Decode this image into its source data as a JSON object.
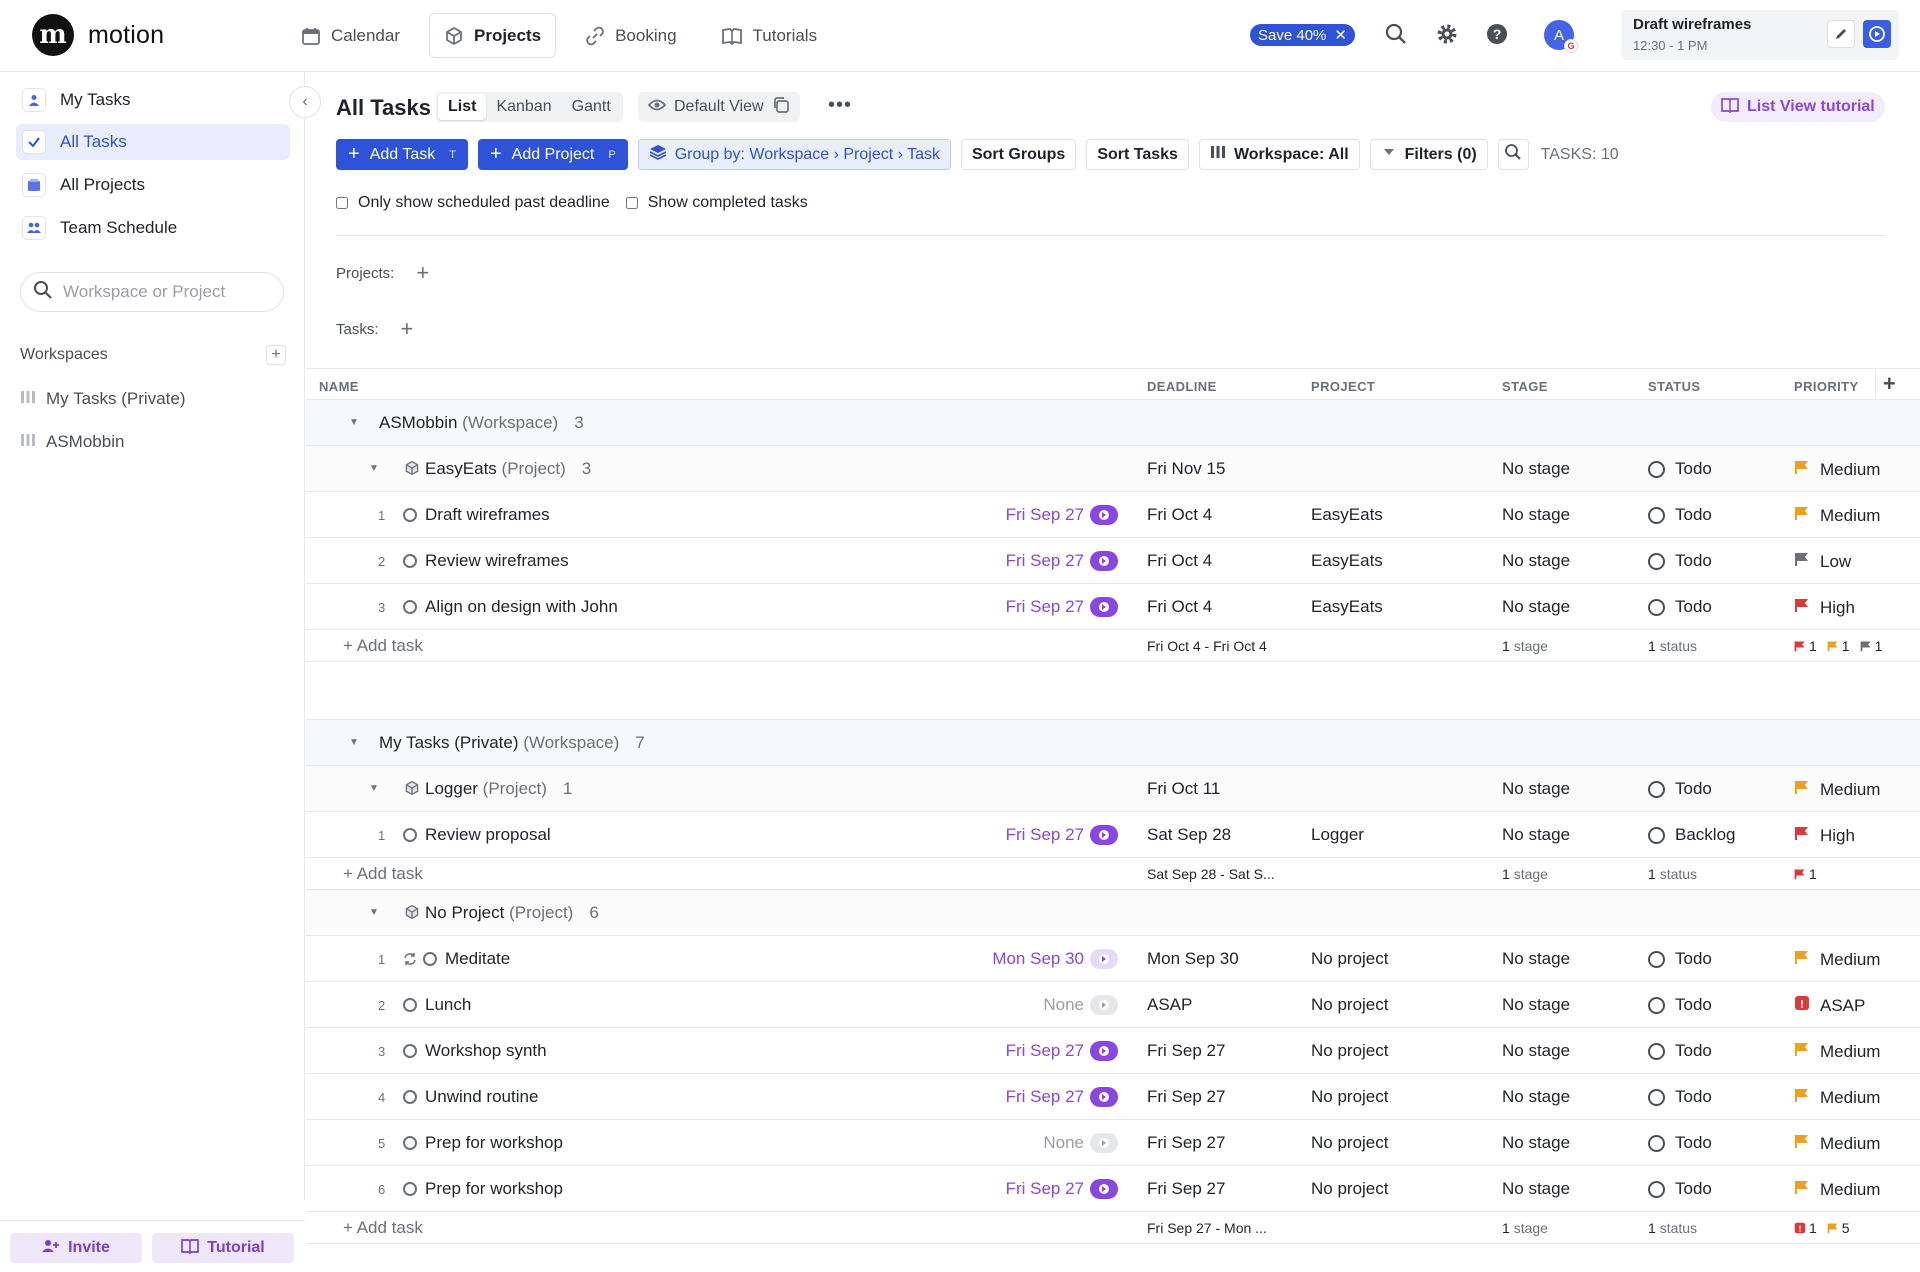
{
  "app": {
    "name": "motion"
  },
  "nav": {
    "calendar": "Calendar",
    "projects": "Projects",
    "booking": "Booking",
    "tutorials": "Tutorials"
  },
  "promo": {
    "label": "Save 40%"
  },
  "user": {
    "initial": "A"
  },
  "current_task": {
    "title": "Draft wireframes",
    "time": "12:30 - 1 PM"
  },
  "sidebar": {
    "items": [
      {
        "label": "My Tasks"
      },
      {
        "label": "All Tasks"
      },
      {
        "label": "All Projects"
      },
      {
        "label": "Team Schedule"
      }
    ],
    "search_placeholder": "Workspace or Project",
    "workspaces_heading": "Workspaces",
    "workspaces": [
      {
        "label": "My Tasks (Private)"
      },
      {
        "label": "ASMobbin"
      }
    ],
    "invite": "Invite",
    "tutorial": "Tutorial"
  },
  "page": {
    "title": "All Tasks",
    "view_tabs": [
      "List",
      "Kanban",
      "Gantt"
    ],
    "default_view": "Default View",
    "tutorial_link": "List View tutorial",
    "toolbar": {
      "add_task": "Add Task",
      "add_task_key": "T",
      "add_project": "Add Project",
      "add_project_key": "P",
      "group_by": "Group by: Workspace › Project › Task",
      "sort_groups": "Sort Groups",
      "sort_tasks": "Sort Tasks",
      "workspace": "Workspace: All",
      "filters": "Filters (0)",
      "task_count": "TASKS: 10"
    },
    "checks": {
      "past_deadline": "Only show scheduled past deadline",
      "show_completed": "Show completed tasks"
    },
    "filters": {
      "projects": "Projects:",
      "tasks": "Tasks:"
    }
  },
  "table": {
    "headers": {
      "name": "NAME",
      "deadline": "DEADLINE",
      "project": "PROJECT",
      "stage": "STAGE",
      "status": "STATUS",
      "priority": "PRIORITY"
    },
    "add_task": "Add task",
    "groups": [
      {
        "workspace": "ASMobbin",
        "ws_suffix": "(Workspace)",
        "count": "3",
        "project": "EasyEats",
        "proj_suffix": "(Project)",
        "proj_count": "3",
        "proj_deadline": "Fri Nov 15",
        "proj_stage": "No stage",
        "proj_status": "Todo",
        "proj_priority": "Medium",
        "tasks": [
          {
            "n": "1",
            "name": "Draft wireframes",
            "scheduled": "Fri Sep 27",
            "deadline": "Fri Oct 4",
            "project": "EasyEats",
            "stage": "No stage",
            "status": "Todo",
            "priority": "Medium"
          },
          {
            "n": "2",
            "name": "Review wireframes",
            "scheduled": "Fri Sep 27",
            "deadline": "Fri Oct 4",
            "project": "EasyEats",
            "stage": "No stage",
            "status": "Todo",
            "priority": "Low"
          },
          {
            "n": "3",
            "name": "Align on design with John",
            "scheduled": "Fri Sep 27",
            "deadline": "Fri Oct 4",
            "project": "EasyEats",
            "stage": "No stage",
            "status": "Todo",
            "priority": "High"
          }
        ],
        "summary": {
          "deadline": "Fri Oct 4 - Fri Oct 4",
          "stage_n": "1",
          "stage_lbl": "stage",
          "status_n": "1",
          "status_lbl": "status",
          "p_high": "1",
          "p_med": "1",
          "p_low": "1"
        }
      },
      {
        "workspace": "My Tasks (Private)",
        "ws_suffix": "(Workspace)",
        "count": "7",
        "project": "Logger",
        "proj_suffix": "(Project)",
        "proj_count": "1",
        "proj_deadline": "Fri Oct 11",
        "proj_stage": "No stage",
        "proj_status": "Todo",
        "proj_priority": "Medium",
        "tasks": [
          {
            "n": "1",
            "name": "Review proposal",
            "scheduled": "Fri Sep 27",
            "deadline": "Sat Sep 28",
            "project": "Logger",
            "stage": "No stage",
            "status": "Backlog",
            "priority": "High"
          }
        ],
        "summary": {
          "deadline": "Sat Sep 28 - Sat S...",
          "stage_n": "1",
          "stage_lbl": "stage",
          "status_n": "1",
          "status_lbl": "status",
          "p_high": "1"
        },
        "project2": "No Project",
        "proj2_suffix": "(Project)",
        "proj2_count": "6",
        "tasks2": [
          {
            "n": "1",
            "name": "Meditate",
            "scheduled": "Mon Sep 30",
            "deadline": "Mon Sep 30",
            "project": "No project",
            "stage": "No stage",
            "status": "Todo",
            "priority": "Medium"
          },
          {
            "n": "2",
            "name": "Lunch",
            "scheduled": "None",
            "deadline": "ASAP",
            "project": "No project",
            "stage": "No stage",
            "status": "Todo",
            "priority": "ASAP"
          },
          {
            "n": "3",
            "name": "Workshop synth",
            "scheduled": "Fri Sep 27",
            "deadline": "Fri Sep 27",
            "project": "No project",
            "stage": "No stage",
            "status": "Todo",
            "priority": "Medium"
          },
          {
            "n": "4",
            "name": "Unwind routine",
            "scheduled": "Fri Sep 27",
            "deadline": "Fri Sep 27",
            "project": "No project",
            "stage": "No stage",
            "status": "Todo",
            "priority": "Medium"
          },
          {
            "n": "5",
            "name": "Prep for workshop",
            "scheduled": "None",
            "deadline": "Fri Sep 27",
            "project": "No project",
            "stage": "No stage",
            "status": "Todo",
            "priority": "Medium"
          },
          {
            "n": "6",
            "name": "Prep for workshop",
            "scheduled": "Fri Sep 27",
            "deadline": "Fri Sep 27",
            "project": "No project",
            "stage": "No stage",
            "status": "Todo",
            "priority": "Medium"
          }
        ],
        "summary2": {
          "deadline": "Fri Sep 27 - Mon ...",
          "stage_n": "1",
          "stage_lbl": "stage",
          "status_n": "1",
          "status_lbl": "status",
          "p_asap": "1",
          "p_med": "5"
        }
      }
    ]
  },
  "colors": {
    "accent": "#2e52d8",
    "purple": "#8a46e0",
    "high": "#d93a3a",
    "medium": "#f0a020",
    "low": "#6b7079"
  }
}
